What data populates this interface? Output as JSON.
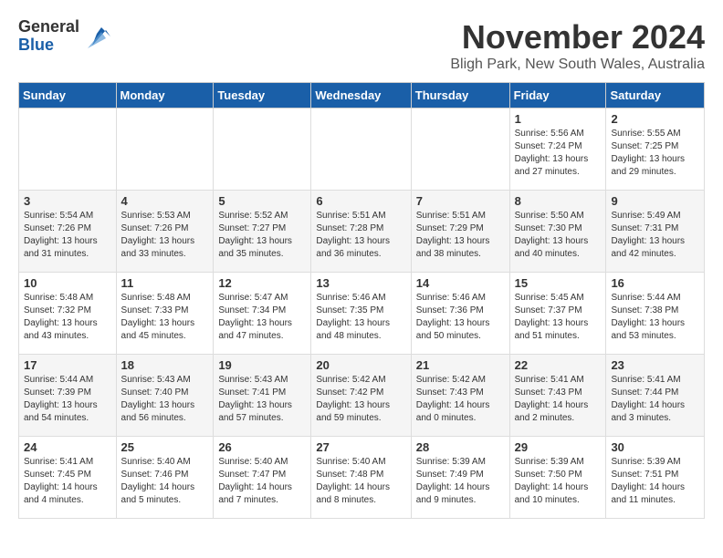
{
  "logo": {
    "general": "General",
    "blue": "Blue"
  },
  "title": "November 2024",
  "location": "Bligh Park, New South Wales, Australia",
  "headers": [
    "Sunday",
    "Monday",
    "Tuesday",
    "Wednesday",
    "Thursday",
    "Friday",
    "Saturday"
  ],
  "weeks": [
    [
      {
        "day": "",
        "info": ""
      },
      {
        "day": "",
        "info": ""
      },
      {
        "day": "",
        "info": ""
      },
      {
        "day": "",
        "info": ""
      },
      {
        "day": "",
        "info": ""
      },
      {
        "day": "1",
        "info": "Sunrise: 5:56 AM\nSunset: 7:24 PM\nDaylight: 13 hours\nand 27 minutes."
      },
      {
        "day": "2",
        "info": "Sunrise: 5:55 AM\nSunset: 7:25 PM\nDaylight: 13 hours\nand 29 minutes."
      }
    ],
    [
      {
        "day": "3",
        "info": "Sunrise: 5:54 AM\nSunset: 7:26 PM\nDaylight: 13 hours\nand 31 minutes."
      },
      {
        "day": "4",
        "info": "Sunrise: 5:53 AM\nSunset: 7:26 PM\nDaylight: 13 hours\nand 33 minutes."
      },
      {
        "day": "5",
        "info": "Sunrise: 5:52 AM\nSunset: 7:27 PM\nDaylight: 13 hours\nand 35 minutes."
      },
      {
        "day": "6",
        "info": "Sunrise: 5:51 AM\nSunset: 7:28 PM\nDaylight: 13 hours\nand 36 minutes."
      },
      {
        "day": "7",
        "info": "Sunrise: 5:51 AM\nSunset: 7:29 PM\nDaylight: 13 hours\nand 38 minutes."
      },
      {
        "day": "8",
        "info": "Sunrise: 5:50 AM\nSunset: 7:30 PM\nDaylight: 13 hours\nand 40 minutes."
      },
      {
        "day": "9",
        "info": "Sunrise: 5:49 AM\nSunset: 7:31 PM\nDaylight: 13 hours\nand 42 minutes."
      }
    ],
    [
      {
        "day": "10",
        "info": "Sunrise: 5:48 AM\nSunset: 7:32 PM\nDaylight: 13 hours\nand 43 minutes."
      },
      {
        "day": "11",
        "info": "Sunrise: 5:48 AM\nSunset: 7:33 PM\nDaylight: 13 hours\nand 45 minutes."
      },
      {
        "day": "12",
        "info": "Sunrise: 5:47 AM\nSunset: 7:34 PM\nDaylight: 13 hours\nand 47 minutes."
      },
      {
        "day": "13",
        "info": "Sunrise: 5:46 AM\nSunset: 7:35 PM\nDaylight: 13 hours\nand 48 minutes."
      },
      {
        "day": "14",
        "info": "Sunrise: 5:46 AM\nSunset: 7:36 PM\nDaylight: 13 hours\nand 50 minutes."
      },
      {
        "day": "15",
        "info": "Sunrise: 5:45 AM\nSunset: 7:37 PM\nDaylight: 13 hours\nand 51 minutes."
      },
      {
        "day": "16",
        "info": "Sunrise: 5:44 AM\nSunset: 7:38 PM\nDaylight: 13 hours\nand 53 minutes."
      }
    ],
    [
      {
        "day": "17",
        "info": "Sunrise: 5:44 AM\nSunset: 7:39 PM\nDaylight: 13 hours\nand 54 minutes."
      },
      {
        "day": "18",
        "info": "Sunrise: 5:43 AM\nSunset: 7:40 PM\nDaylight: 13 hours\nand 56 minutes."
      },
      {
        "day": "19",
        "info": "Sunrise: 5:43 AM\nSunset: 7:41 PM\nDaylight: 13 hours\nand 57 minutes."
      },
      {
        "day": "20",
        "info": "Sunrise: 5:42 AM\nSunset: 7:42 PM\nDaylight: 13 hours\nand 59 minutes."
      },
      {
        "day": "21",
        "info": "Sunrise: 5:42 AM\nSunset: 7:43 PM\nDaylight: 14 hours\nand 0 minutes."
      },
      {
        "day": "22",
        "info": "Sunrise: 5:41 AM\nSunset: 7:43 PM\nDaylight: 14 hours\nand 2 minutes."
      },
      {
        "day": "23",
        "info": "Sunrise: 5:41 AM\nSunset: 7:44 PM\nDaylight: 14 hours\nand 3 minutes."
      }
    ],
    [
      {
        "day": "24",
        "info": "Sunrise: 5:41 AM\nSunset: 7:45 PM\nDaylight: 14 hours\nand 4 minutes."
      },
      {
        "day": "25",
        "info": "Sunrise: 5:40 AM\nSunset: 7:46 PM\nDaylight: 14 hours\nand 5 minutes."
      },
      {
        "day": "26",
        "info": "Sunrise: 5:40 AM\nSunset: 7:47 PM\nDaylight: 14 hours\nand 7 minutes."
      },
      {
        "day": "27",
        "info": "Sunrise: 5:40 AM\nSunset: 7:48 PM\nDaylight: 14 hours\nand 8 minutes."
      },
      {
        "day": "28",
        "info": "Sunrise: 5:39 AM\nSunset: 7:49 PM\nDaylight: 14 hours\nand 9 minutes."
      },
      {
        "day": "29",
        "info": "Sunrise: 5:39 AM\nSunset: 7:50 PM\nDaylight: 14 hours\nand 10 minutes."
      },
      {
        "day": "30",
        "info": "Sunrise: 5:39 AM\nSunset: 7:51 PM\nDaylight: 14 hours\nand 11 minutes."
      }
    ]
  ]
}
